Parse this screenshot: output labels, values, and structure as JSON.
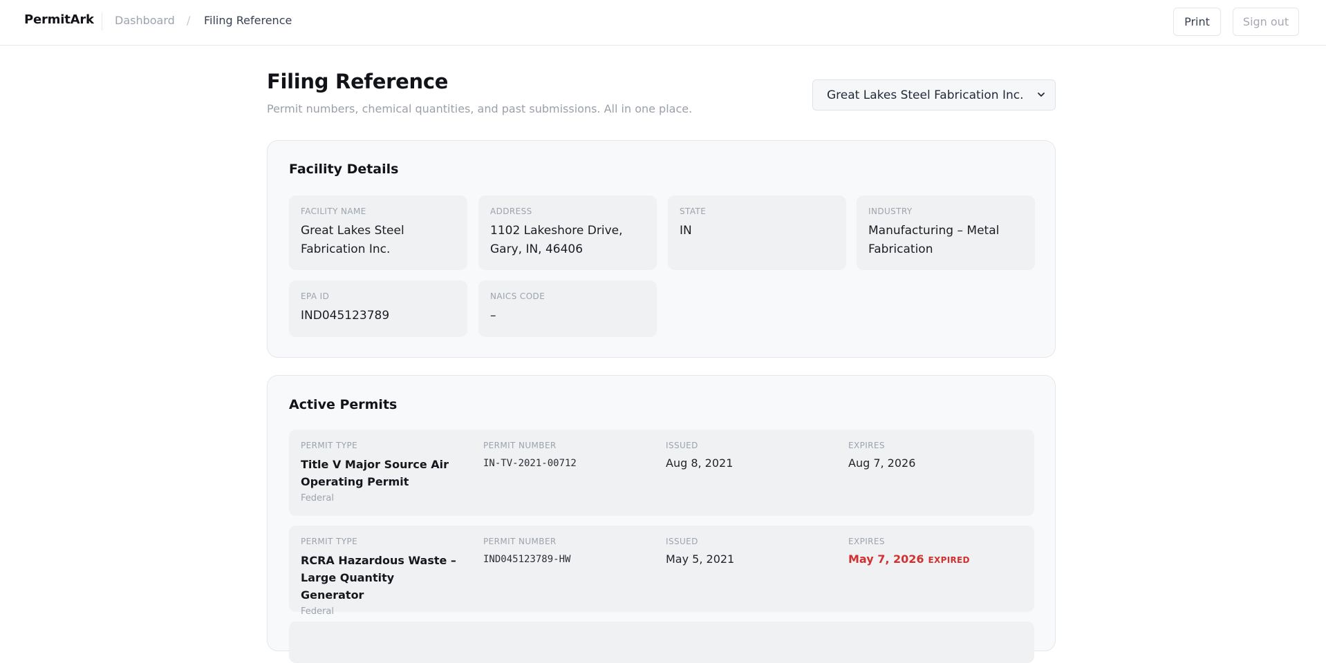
{
  "header": {
    "brand": "PermitArk",
    "breadcrumb": {
      "parent": "Dashboard",
      "separator": "/",
      "current": "Filing Reference"
    },
    "actions": {
      "print": "Print",
      "sign_out": "Sign out"
    }
  },
  "page": {
    "title": "Filing Reference",
    "subtitle": "Permit numbers, chemical quantities, and past submissions. All in one place.",
    "facility_select": {
      "selected": "Great Lakes Steel Fabrication Inc."
    }
  },
  "facility": {
    "title": "Facility Details",
    "fields": [
      {
        "label": "Facility Name",
        "value": "Great Lakes Steel Fabrication Inc."
      },
      {
        "label": "Address",
        "value": "1102 Lakeshore Drive, Gary, IN, 46406"
      },
      {
        "label": "State",
        "value": "IN"
      },
      {
        "label": "Industry",
        "value": "Manufacturing – Metal Fabrication"
      },
      {
        "label": "EPA ID",
        "value": "IND045123789"
      },
      {
        "label": "NAICS Code",
        "value": "–"
      }
    ]
  },
  "permits": {
    "title": "Active Permits",
    "columns": {
      "type": "Permit Type",
      "number": "Permit Number",
      "issued": "Issued",
      "expires": "Expires"
    },
    "rows": [
      {
        "type": "Title V Major Source Air Operating Permit",
        "jurisdiction": "Federal",
        "number": "IN-TV-2021-00712",
        "issued": "Aug 8, 2021",
        "expires": "Aug 7, 2026",
        "status": ""
      },
      {
        "type": "RCRA Hazardous Waste – Large Quantity Generator",
        "jurisdiction": "Federal",
        "number": "IND045123789-HW",
        "issued": "May 5, 2021",
        "expires": "May 7, 2026",
        "status": "EXPIRED"
      }
    ]
  },
  "colors": {
    "expired": "#d1312f",
    "card_bg": "#f8f9fa",
    "field_bg": "#eff1f3"
  }
}
